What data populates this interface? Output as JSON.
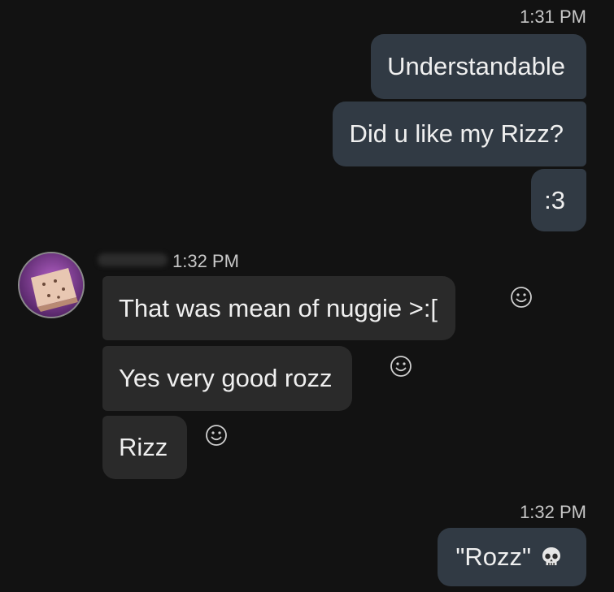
{
  "messages": {
    "outgoing_1": {
      "timestamp": "1:31 PM",
      "lines": [
        "Understandable",
        "Did u like my Rizz?",
        ":3"
      ]
    },
    "incoming": {
      "timestamp": "1:32 PM",
      "lines": [
        "That was mean of nuggie >:[",
        "Yes very good rozz",
        "Rizz"
      ]
    },
    "outgoing_2": {
      "timestamp": "1:32 PM",
      "text": "\"Rozz\"",
      "emoji": "skull-icon"
    }
  },
  "colors": {
    "background": "#121212",
    "outgoing_bubble": "#313a44",
    "incoming_bubble": "#2a2a2a",
    "text": "#efefef",
    "timestamp": "#c8c8c8"
  }
}
